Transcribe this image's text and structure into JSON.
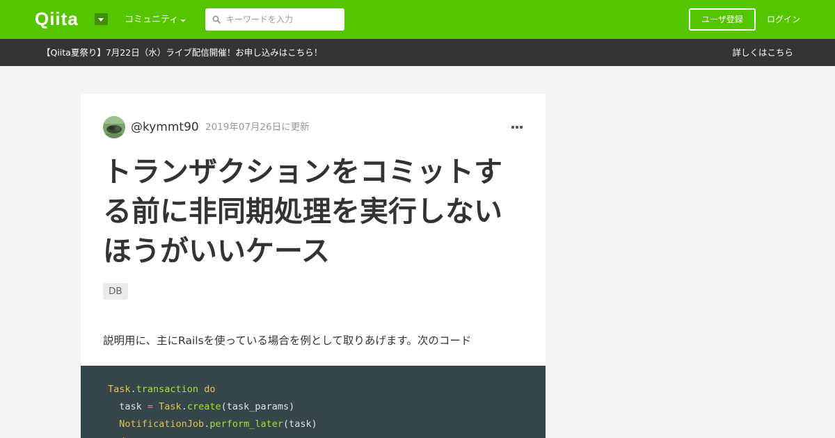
{
  "header": {
    "logo": "Qiita",
    "community_label": "コミュニティ",
    "search_placeholder": "キーワードを入力",
    "signup_label": "ユーザ登録",
    "login_label": "ログイン"
  },
  "announcement": {
    "text": "【Qiita夏祭り】7月22日（水）ライブ配信開催！お申し込みはこちら！",
    "link": "詳しくはこちら"
  },
  "article": {
    "author": "@kymmt90",
    "updated": "2019年07月26日に更新",
    "title": "トランザクションをコミットする前に非同期処理を実行しないほうがいいケース",
    "tags": [
      "DB"
    ],
    "intro": "説明用に、主にRailsを使っている場合を例として取りあげます。次のコード",
    "code": {
      "line1": {
        "const": "Task",
        "dot": ".",
        "method": "transaction",
        "space": " ",
        "keyword": "do"
      },
      "line2": {
        "indent": "  ",
        "var": "task",
        "op": " = ",
        "const": "Task",
        "dot": ".",
        "method": "create",
        "args": "(task_params)"
      },
      "line3": {
        "indent": "  ",
        "const": "NotificationJob",
        "dot": ".",
        "method": "perform_later",
        "args": "(task)"
      },
      "line4": {
        "keyword": "end"
      }
    }
  },
  "icons": {
    "search": "search-icon",
    "menu_caret": "chevron-down-icon",
    "more": "more-horizontal-icon",
    "avatar": "avatar"
  },
  "colors": {
    "brand_green": "#55c500",
    "announce_bg": "#333333",
    "page_bg": "#f5f5f3",
    "code_bg": "#364549"
  }
}
